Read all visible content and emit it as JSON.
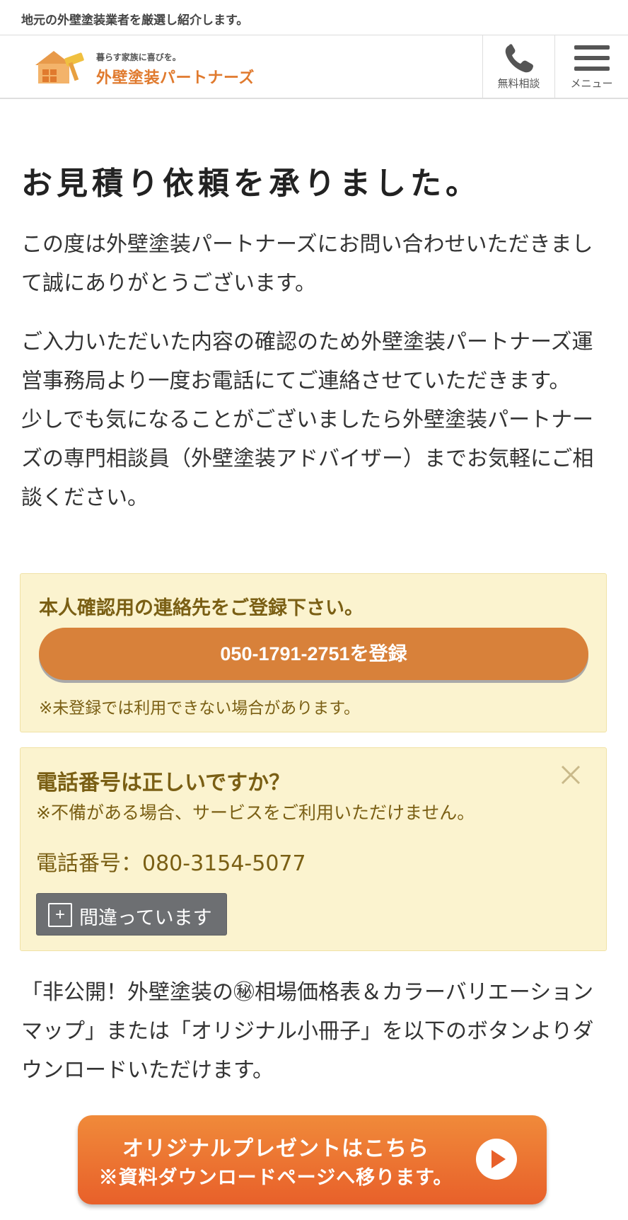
{
  "topbar": {
    "text": "地元の外壁塗装業者を厳選し紹介します。"
  },
  "header": {
    "logo_tagline": "暮らす家族に喜びを。",
    "logo_name": "外壁塗装パートナーズ",
    "phone_label": "無料相談",
    "menu_label": "メニュー",
    "phone_icon": "phone-icon",
    "menu_icon": "hamburger-menu-icon"
  },
  "main": {
    "title": "お見積り依頼を承りました。",
    "para1": "この度は外壁塗装パートナーズにお問い合わせいただきまして誠にありがとうございます。",
    "para2a": "ご入力いただいた内容の確認のため外壁塗装パートナーズ運営事務局より一度お電話にてご連絡させていただきます。",
    "para2b": "少しでも気になることがございましたら外壁塗装パートナーズの専門相談員（外壁塗装アドバイザー）までお気軽にご相談ください。"
  },
  "register_box": {
    "title": "本人確認用の連絡先をご登録下さい。",
    "button_label": "050-1791-2751を登録",
    "note": "※未登録では利用できない場合があります。"
  },
  "verify_box": {
    "title": "電話番号は正しいですか？",
    "subtitle": "※不備がある場合、サービスをご利用いただけません。",
    "phone_text": "電話番号：080-3154-5077",
    "wrong_button_label": "間違っています",
    "plus_symbol": "+",
    "close_icon": "close-icon"
  },
  "download": {
    "text": "「非公開！外壁塗装の㊙相場価格表＆カラーバリエーションマップ」または「オリジナル小冊子」を以下のボタンよりダウンロードいただけます。"
  },
  "cta": {
    "line1": "オリジナルプレゼントはこちら",
    "line2": "※資料ダウンロードページへ移ります。",
    "icon": "play-icon"
  },
  "colors": {
    "accent": "#e07a2e",
    "notice_bg": "#fbf3cf",
    "notice_text": "#7a5f14",
    "cta_gradient_top": "#f08a3a",
    "cta_gradient_bottom": "#e8602a",
    "grey_button": "#6d6f72"
  }
}
